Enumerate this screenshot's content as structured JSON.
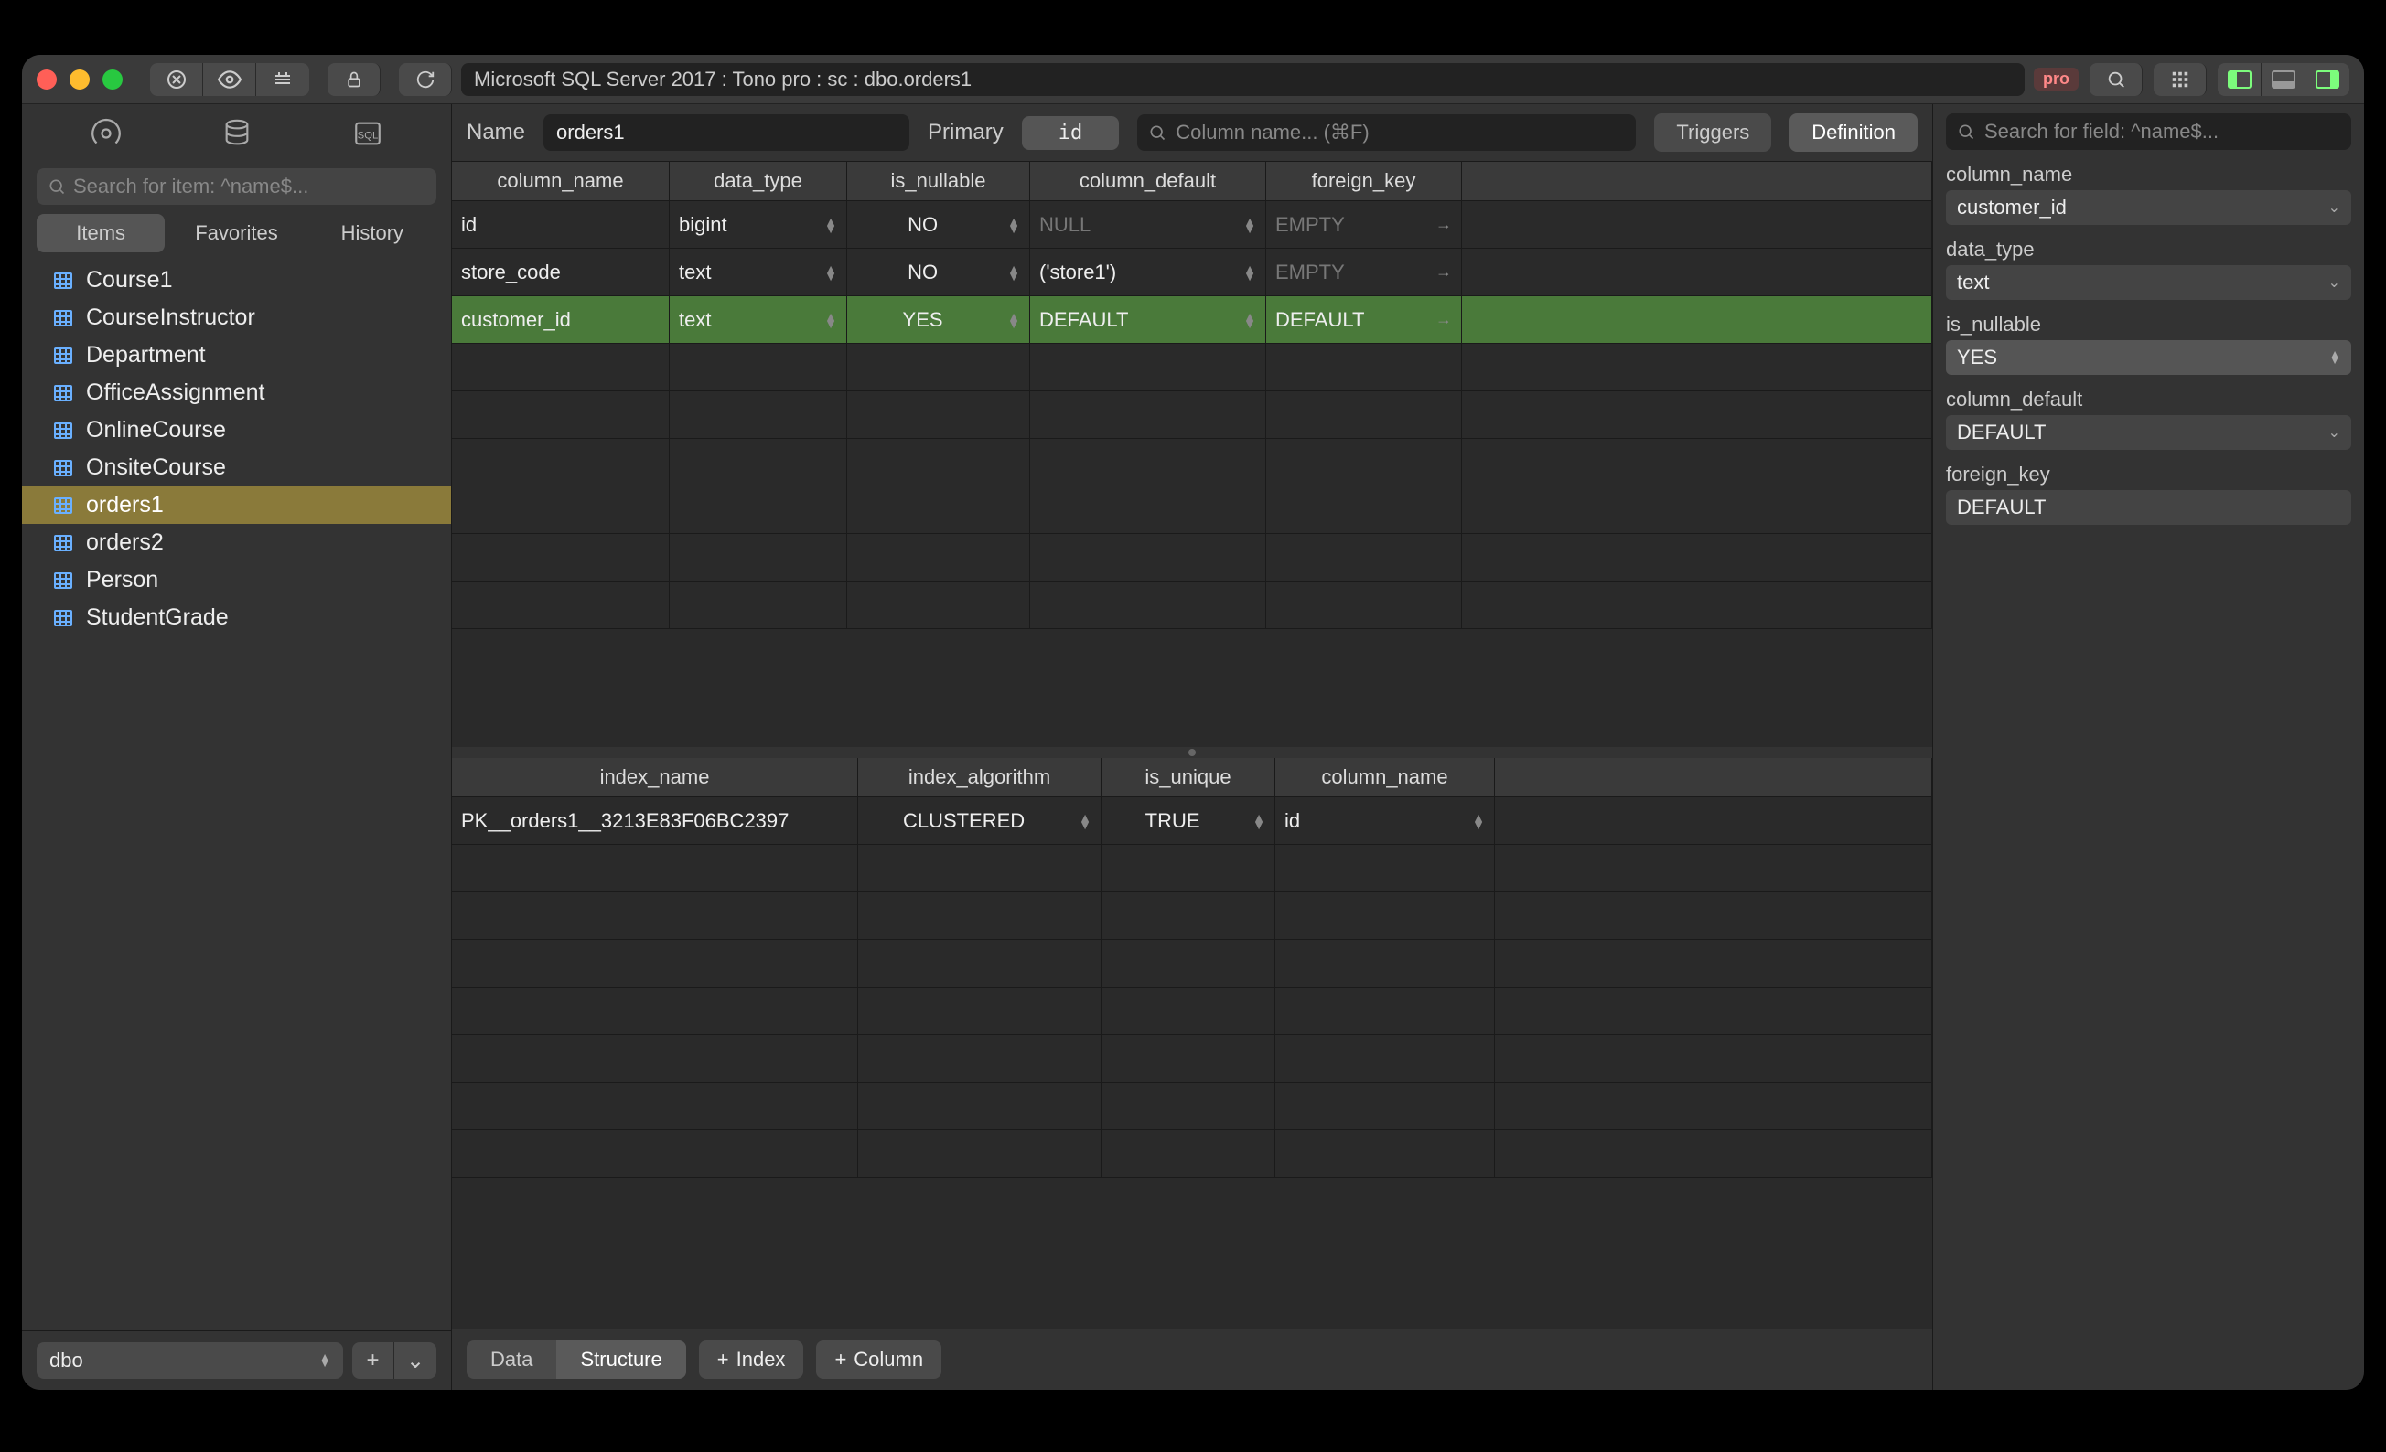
{
  "breadcrumb": "Microsoft SQL Server 2017 : Tono pro : sc : dbo.orders1",
  "pro_badge": "pro",
  "sidebar": {
    "search_placeholder": "Search for item: ^name$...",
    "tabs": [
      "Items",
      "Favorites",
      "History"
    ],
    "active_tab": 0,
    "items": [
      {
        "label": "Course1"
      },
      {
        "label": "CourseInstructor"
      },
      {
        "label": "Department"
      },
      {
        "label": "OfficeAssignment"
      },
      {
        "label": "OnlineCourse"
      },
      {
        "label": "OnsiteCourse"
      },
      {
        "label": "orders1",
        "selected": true
      },
      {
        "label": "orders2"
      },
      {
        "label": "Person"
      },
      {
        "label": "StudentGrade"
      }
    ],
    "schema": "dbo"
  },
  "header": {
    "name_label": "Name",
    "name_value": "orders1",
    "primary_label": "Primary",
    "primary_value": "id",
    "col_search_placeholder": "Column name... (⌘F)",
    "triggers_btn": "Triggers",
    "definition_btn": "Definition"
  },
  "columns_grid": {
    "headers": [
      "column_name",
      "data_type",
      "is_nullable",
      "column_default",
      "foreign_key"
    ],
    "rows": [
      {
        "column_name": "id",
        "data_type": "bigint",
        "is_nullable": "NO",
        "column_default": "NULL",
        "cd_muted": true,
        "foreign_key": "EMPTY",
        "fk_muted": true
      },
      {
        "column_name": "store_code",
        "data_type": "text",
        "is_nullable": "NO",
        "column_default": "('store1')",
        "cd_muted": false,
        "foreign_key": "EMPTY",
        "fk_muted": true
      },
      {
        "column_name": "customer_id",
        "data_type": "text",
        "is_nullable": "YES",
        "column_default": "DEFAULT",
        "cd_muted": false,
        "foreign_key": "DEFAULT",
        "fk_muted": false,
        "selected": true
      }
    ],
    "empty_rows": 6
  },
  "index_grid": {
    "headers": [
      "index_name",
      "index_algorithm",
      "is_unique",
      "column_name"
    ],
    "rows": [
      {
        "index_name": "PK__orders1__3213E83F06BC2397",
        "index_algorithm": "CLUSTERED",
        "is_unique": "TRUE",
        "column_name": "id"
      }
    ],
    "empty_rows": 7
  },
  "footer": {
    "data_btn": "Data",
    "structure_btn": "Structure",
    "index_btn": "Index",
    "column_btn": "Column"
  },
  "inspector": {
    "search_placeholder": "Search for field: ^name$...",
    "fields": [
      {
        "label": "column_name",
        "value": "customer_id",
        "type": "dropdown"
      },
      {
        "label": "data_type",
        "value": "text",
        "type": "dropdown"
      },
      {
        "label": "is_nullable",
        "value": "YES",
        "type": "stepper"
      },
      {
        "label": "column_default",
        "value": "DEFAULT",
        "type": "dropdown"
      },
      {
        "label": "foreign_key",
        "value": "DEFAULT",
        "type": "text"
      }
    ]
  }
}
